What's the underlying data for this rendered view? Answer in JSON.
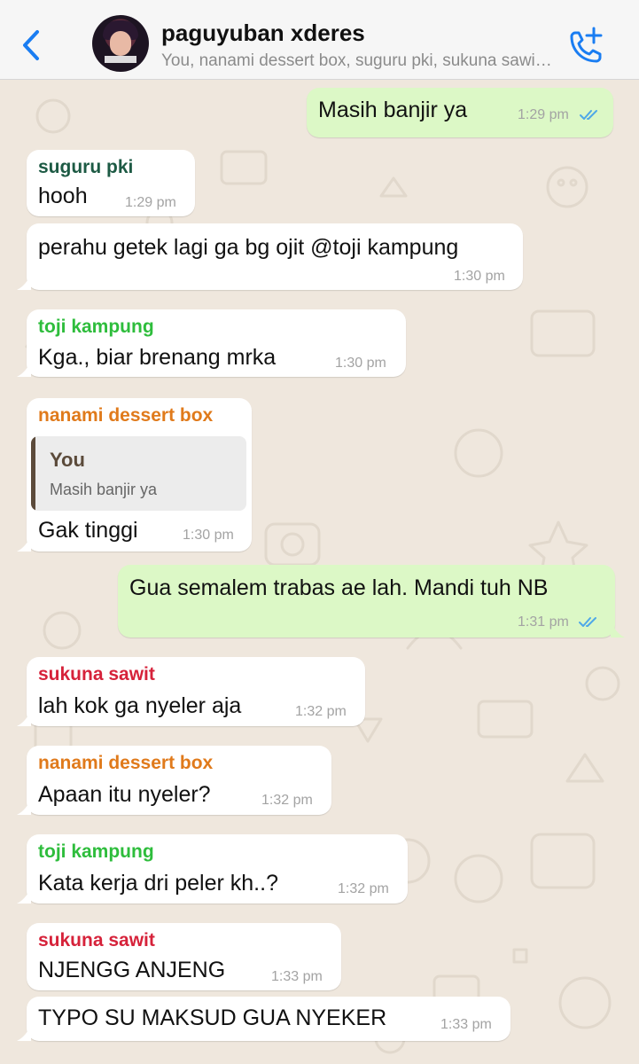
{
  "header": {
    "title": "paguyuban xderes",
    "subtitle": "You, nanami dessert box, suguru pki, sukuna sawit, toji kampung",
    "back_icon": "chevron-left-icon",
    "call_icon": "add-call-icon",
    "accent": "#1a7df2"
  },
  "colors": {
    "outgoing_bubble": "#dcf8c6",
    "incoming_bubble": "#ffffff",
    "read_ticks": "#4fa8e8",
    "suguru": "#1d5a44",
    "toji": "#2ebd3c",
    "nanami": "#e07a1b",
    "sukuna": "#d6223a"
  },
  "messages": {
    "m1": {
      "text": "Masih banjir ya",
      "time": "1:29 pm"
    },
    "m2": {
      "sender": "suguru pki",
      "text": "hooh",
      "time": "1:29 pm"
    },
    "m3": {
      "text": "perahu getek lagi ga bg ojit @toji kampung",
      "time": "1:30 pm"
    },
    "m4": {
      "sender": "toji kampung",
      "text": "Kga., biar brenang mrka",
      "time": "1:30 pm"
    },
    "m5": {
      "sender": "nanami dessert box",
      "quote_name": "You",
      "quote_text": "Masih banjir ya",
      "text": "Gak tinggi",
      "time": "1:30 pm"
    },
    "m6": {
      "text": "Gua semalem trabas ae lah. Mandi tuh NB",
      "time": "1:31 pm"
    },
    "m7": {
      "sender": "sukuna sawit",
      "text": "lah kok ga nyeler aja",
      "time": "1:32 pm"
    },
    "m8": {
      "sender": "nanami dessert box",
      "text": "Apaan itu nyeler?",
      "time": "1:32 pm"
    },
    "m9": {
      "sender": "toji kampung",
      "text": "Kata kerja dri peler kh..?",
      "time": "1:32 pm"
    },
    "m10": {
      "sender": "sukuna sawit",
      "text": "NJENGG ANJENG",
      "time": "1:33 pm"
    },
    "m11": {
      "text": "TYPO SU MAKSUD GUA NYEKER",
      "time": "1:33 pm"
    }
  }
}
